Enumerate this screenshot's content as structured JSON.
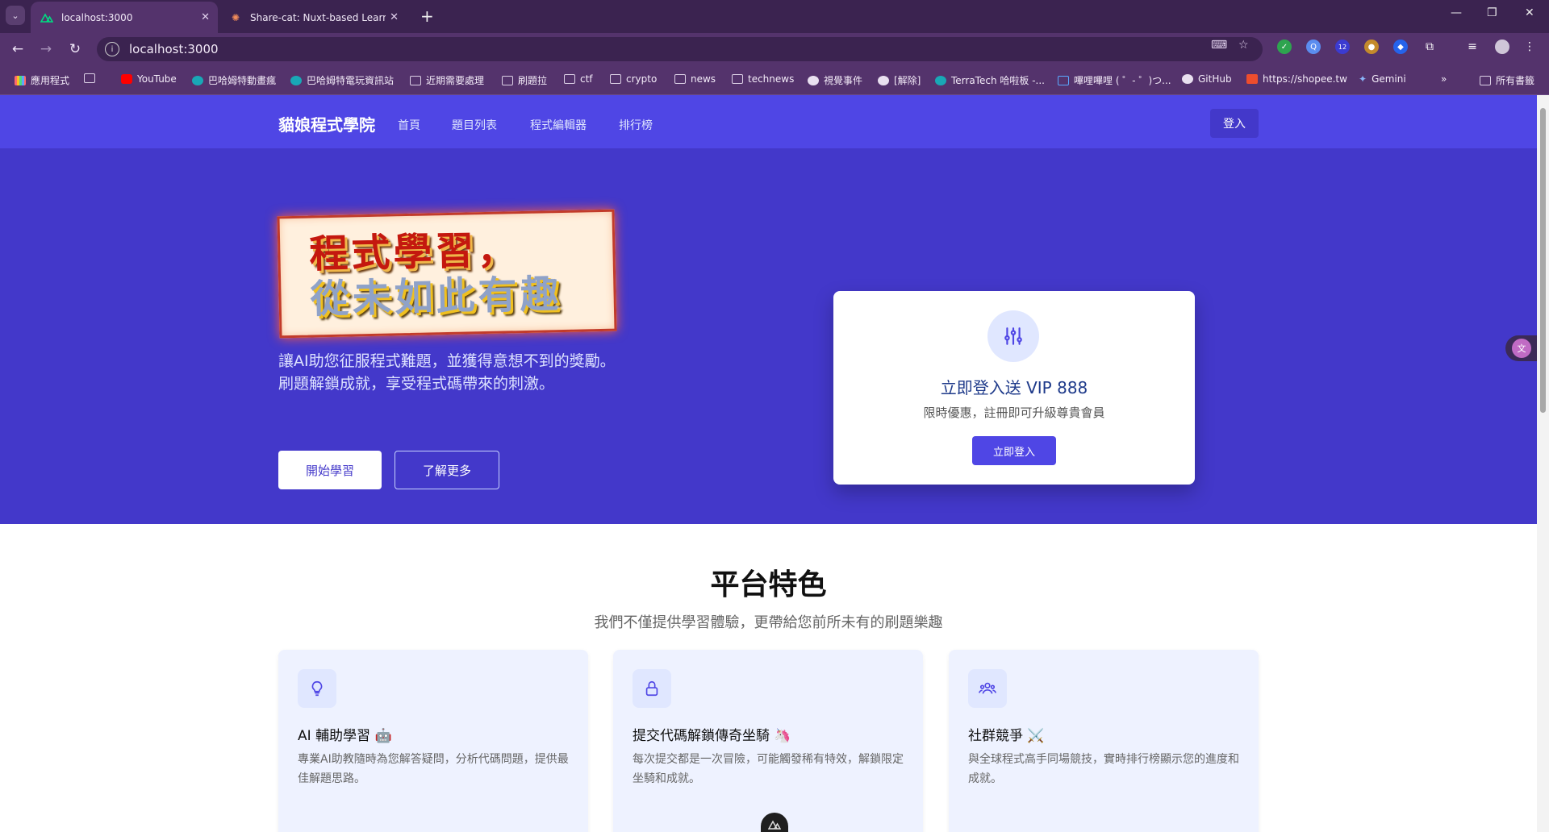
{
  "browser": {
    "tabs": [
      {
        "title": "localhost:3000",
        "active": true
      },
      {
        "title": "Share-cat: Nuxt-based Learnin",
        "active": false
      }
    ],
    "url": "localhost:3000",
    "bookmarks": [
      "應用程式",
      "YouTube",
      "巴哈姆特動畫瘋",
      "巴哈姆特電玩資訊站",
      "近期需要處理",
      "刷題拉",
      "ctf",
      "crypto",
      "news",
      "technews",
      "視覺事件",
      "[解除]",
      "TerraTech 哈啦板 -...",
      "嗶哩嗶哩 ( ゜- ゜)つ...",
      "GitHub",
      "https://shopee.tw",
      "Gemini",
      "所有書籤"
    ],
    "extension_badge": "12"
  },
  "navbar": {
    "brand": "貓娘程式學院",
    "links": [
      "首頁",
      "題目列表",
      "程式編輯器",
      "排行榜"
    ],
    "login": "登入"
  },
  "hero": {
    "banner_line1": "程式學習，",
    "banner_line2": "從未如此有趣",
    "subtitle_line1": "讓AI助您征服程式難題，並獲得意想不到的獎勵。",
    "subtitle_line2": "刷題解鎖成就，享受程式碼帶來的刺激。",
    "start_button": "開始學習",
    "more_button": "了解更多"
  },
  "vip_card": {
    "title": "立即登入送 VIP 888",
    "description": "限時優惠，註冊即可升級尊貴會員",
    "button": "立即登入"
  },
  "features": {
    "title": "平台特色",
    "subtitle": "我們不僅提供學習體驗，更帶給您前所未有的刷題樂趣",
    "cards": [
      {
        "icon": "lightbulb-icon",
        "title": "AI 輔助學習 🤖",
        "description": "專業AI助教隨時為您解答疑問，分析代碼問題，提供最佳解題思路。"
      },
      {
        "icon": "lock-icon",
        "title": "提交代碼解鎖傳奇坐騎 🦄",
        "description": "每次提交都是一次冒險，可能觸發稀有特效，解鎖限定坐騎和成就。"
      },
      {
        "icon": "users-icon",
        "title": "社群競爭 ⚔️",
        "description": "與全球程式高手同場競技，實時排行榜顯示您的進度和成就。"
      }
    ]
  },
  "colors": {
    "primary": "#4f46e5",
    "hero": "#4338ca",
    "browser_frame": "#54336c"
  }
}
